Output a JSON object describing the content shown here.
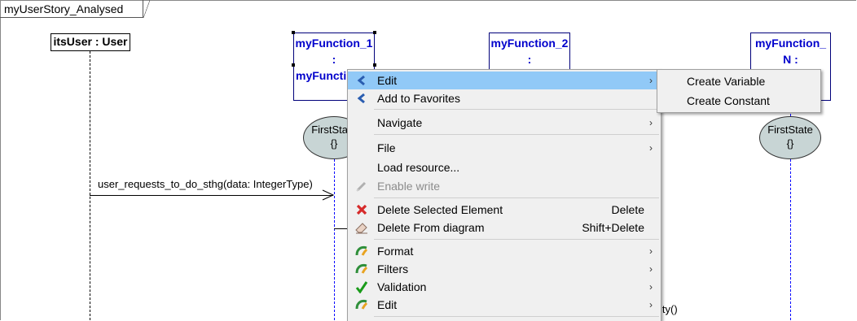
{
  "diagram": {
    "frame_title": "myUserStory_Analysed",
    "lifelines": {
      "user": "itsUser : User",
      "f1": {
        "line1": "myFunction_1",
        "line2": ":",
        "line3": "myFuncti"
      },
      "f2": {
        "line1": "myFunction_2",
        "line2": ":"
      },
      "fn": {
        "line1": "myFunction_",
        "line2": "N :"
      }
    },
    "states": {
      "s1": {
        "name": "FirstState",
        "body": "{}"
      },
      "sn": {
        "name": "FirstState",
        "body": "{}"
      }
    },
    "message": "user_requests_to_do_sthg(data: IntegerType)",
    "partial_text": "ity()"
  },
  "context_menu": {
    "items": [
      {
        "label": "Edit",
        "icon": "blue-chevron-icon",
        "submenu": true,
        "highlighted": true
      },
      {
        "label": "Add to Favorites",
        "icon": "blue-chevron-icon"
      },
      {
        "label": "Navigate",
        "submenu": true
      },
      {
        "label": "File",
        "submenu": true
      },
      {
        "label": "Load resource..."
      },
      {
        "label": "Enable write",
        "icon": "pencil-icon",
        "disabled": true
      },
      {
        "label": "Delete Selected Element",
        "shortcut": "Delete",
        "icon": "red-x-icon"
      },
      {
        "label": "Delete From diagram",
        "shortcut": "Shift+Delete",
        "icon": "eraser-icon"
      },
      {
        "label": "Format",
        "icon": "sirius-icon",
        "submenu": true
      },
      {
        "label": "Filters",
        "icon": "sirius-icon",
        "submenu": true
      },
      {
        "label": "Validation",
        "icon": "green-check-icon",
        "submenu": true
      },
      {
        "label": "Edit",
        "icon": "sirius-icon",
        "submenu": true
      }
    ]
  },
  "submenu": {
    "items": [
      {
        "label": "Create Variable"
      },
      {
        "label": "Create Constant"
      }
    ]
  },
  "colors": {
    "highlight": "#91c9f7",
    "lifeline_blue": "#0000cc",
    "state_fill": "#c8d5d5"
  }
}
